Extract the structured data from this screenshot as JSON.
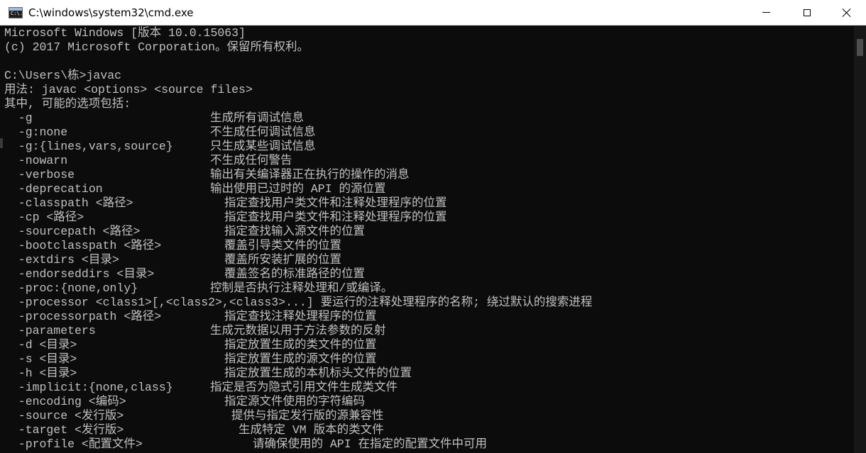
{
  "window": {
    "title": "C:\\windows\\system32\\cmd.exe",
    "icon_name": "cmd-icon",
    "icon_glyph": "C:\\."
  },
  "console": {
    "header": [
      "Microsoft Windows [版本 10.0.15063]",
      "(c) 2017 Microsoft Corporation。保留所有权利。",
      "",
      "C:\\Users\\栋>javac",
      "用法: javac <options> <source files>",
      "其中, 可能的选项包括:"
    ],
    "options": [
      {
        "opt": "  -g",
        "desc": "生成所有调试信息",
        "col": 0
      },
      {
        "opt": "  -g:none",
        "desc": "不生成任何调试信息",
        "col": 0
      },
      {
        "opt": "  -g:{lines,vars,source}",
        "desc": "只生成某些调试信息",
        "col": 0
      },
      {
        "opt": "  -nowarn",
        "desc": "不生成任何警告",
        "col": 0
      },
      {
        "opt": "  -verbose",
        "desc": "输出有关编译器正在执行的操作的消息",
        "col": 0
      },
      {
        "opt": "  -deprecation",
        "desc": "输出使用已过时的 API 的源位置",
        "col": 0
      },
      {
        "opt": "  -classpath <路径>",
        "desc": "指定查找用户类文件和注释处理程序的位置",
        "col": 1
      },
      {
        "opt": "  -cp <路径>",
        "desc": "指定查找用户类文件和注释处理程序的位置",
        "col": 1
      },
      {
        "opt": "  -sourcepath <路径>",
        "desc": "指定查找输入源文件的位置",
        "col": 1
      },
      {
        "opt": "  -bootclasspath <路径>",
        "desc": "覆盖引导类文件的位置",
        "col": 1
      },
      {
        "opt": "  -extdirs <目录>",
        "desc": "覆盖所安装扩展的位置",
        "col": 1
      },
      {
        "opt": "  -endorseddirs <目录>",
        "desc": "覆盖签名的标准路径的位置",
        "col": 1
      },
      {
        "opt": "  -proc:{none,only}",
        "desc": "控制是否执行注释处理和/或编译。",
        "col": 0
      },
      {
        "opt": "  -processor <class1>[,<class2>,<class3>...] 要运行的注释处理程序的名称; 绕过默认的搜索进程",
        "desc": "",
        "col": 0
      },
      {
        "opt": "  -processorpath <路径>",
        "desc": "指定查找注释处理程序的位置",
        "col": 1
      },
      {
        "opt": "  -parameters",
        "desc": "生成元数据以用于方法参数的反射",
        "col": 0
      },
      {
        "opt": "  -d <目录>",
        "desc": "指定放置生成的类文件的位置",
        "col": 1
      },
      {
        "opt": "  -s <目录>",
        "desc": "指定放置生成的源文件的位置",
        "col": 1
      },
      {
        "opt": "  -h <目录>",
        "desc": "指定放置生成的本机标头文件的位置",
        "col": 1
      },
      {
        "opt": "  -implicit:{none,class}",
        "desc": "指定是否为隐式引用文件生成类文件",
        "col": 0
      },
      {
        "opt": "  -encoding <编码>",
        "desc": "指定源文件使用的字符编码",
        "col": 1
      },
      {
        "opt": "  -source <发行版>",
        "desc": "提供与指定发行版的源兼容性",
        "col": 1.5
      },
      {
        "opt": "  -target <发行版>",
        "desc": "生成特定 VM 版本的类文件",
        "col": 2
      },
      {
        "opt": "  -profile <配置文件>",
        "desc": "请确保使用的 API 在指定的配置文件中可用",
        "col": 3
      }
    ]
  },
  "colors": {
    "console_bg": "#0c0c0c",
    "console_fg": "#c0c0c0",
    "titlebar_bg": "#ffffff"
  }
}
